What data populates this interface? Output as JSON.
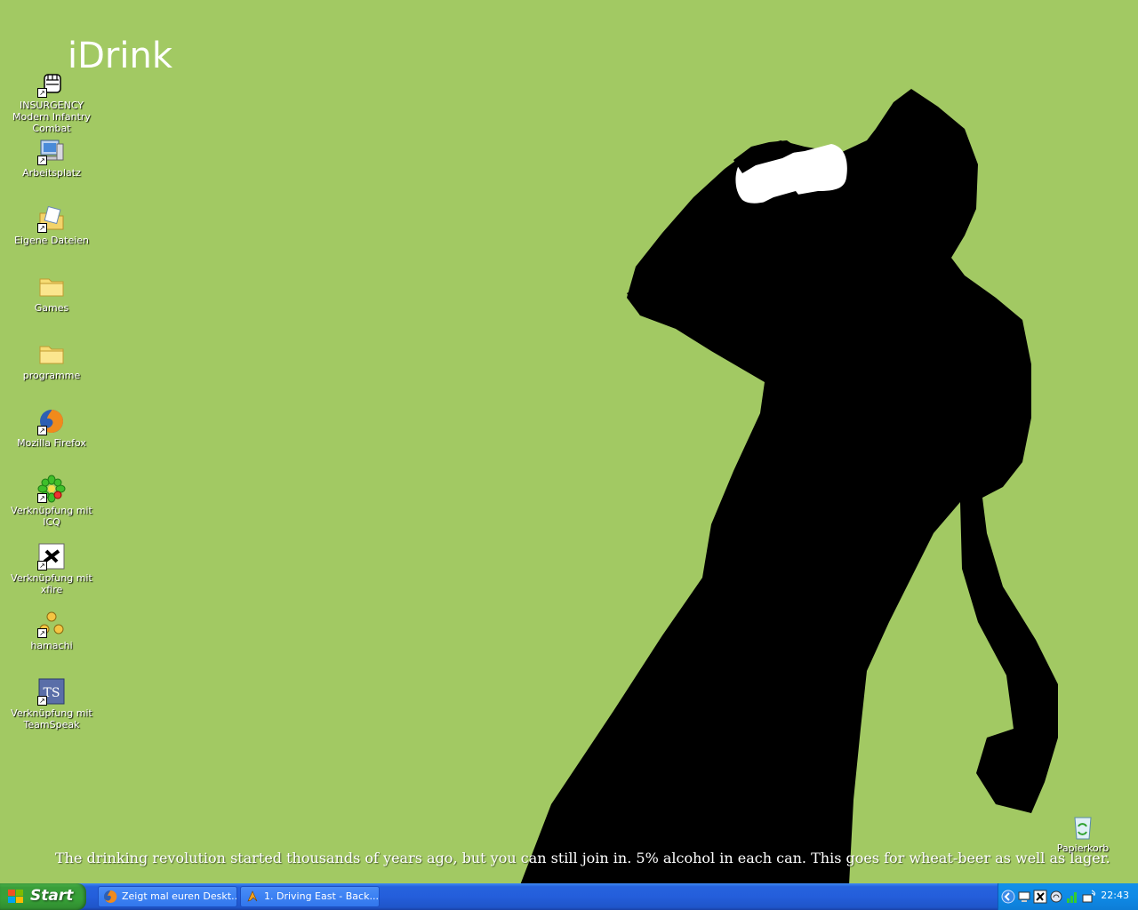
{
  "wallpaper": {
    "brand_text": "iDrink",
    "tagline": "The drinking revolution started thousands of years ago, but you can still join in. 5% alcohol in each can.   This goes for wheat-beer as well as lager.",
    "background_color": "#a2c963",
    "silhouette_color": "#000000"
  },
  "desktop_icons": [
    {
      "label": "INSURGENCY Modern Infantry Combat",
      "icon": "fist-icon"
    },
    {
      "label": "Arbeitsplatz",
      "icon": "computer-icon"
    },
    {
      "label": "Eigene Dateien",
      "icon": "my-documents-icon"
    },
    {
      "label": "Games",
      "icon": "folder-icon"
    },
    {
      "label": "programme",
      "icon": "folder-icon"
    },
    {
      "label": "Mozilla Firefox",
      "icon": "firefox-icon"
    },
    {
      "label": "Verknüpfung mit ICQ",
      "icon": "icq-flower-icon"
    },
    {
      "label": "Verknüpfung mit xfire",
      "icon": "xfire-icon"
    },
    {
      "label": "hamachi",
      "icon": "hamachi-icon"
    },
    {
      "label": "Verknüpfung mit TeamSpeak",
      "icon": "teamspeak-icon"
    }
  ],
  "recycle_bin": {
    "label": "Papierkorb",
    "icon": "recycle-bin-icon"
  },
  "taskbar": {
    "start_label": "Start",
    "tasks": [
      {
        "label": "Zeigt mal euren Deskt...",
        "icon": "firefox-icon"
      },
      {
        "label": "1. Driving East - Back...",
        "icon": "winamp-icon"
      }
    ],
    "tray_icons": [
      "show-hidden-icons-icon",
      "network-icon",
      "xfire-tray-icon",
      "teamspeak-tray-icon",
      "signal-bars-icon",
      "wireless-icon"
    ],
    "clock": "22:43"
  }
}
